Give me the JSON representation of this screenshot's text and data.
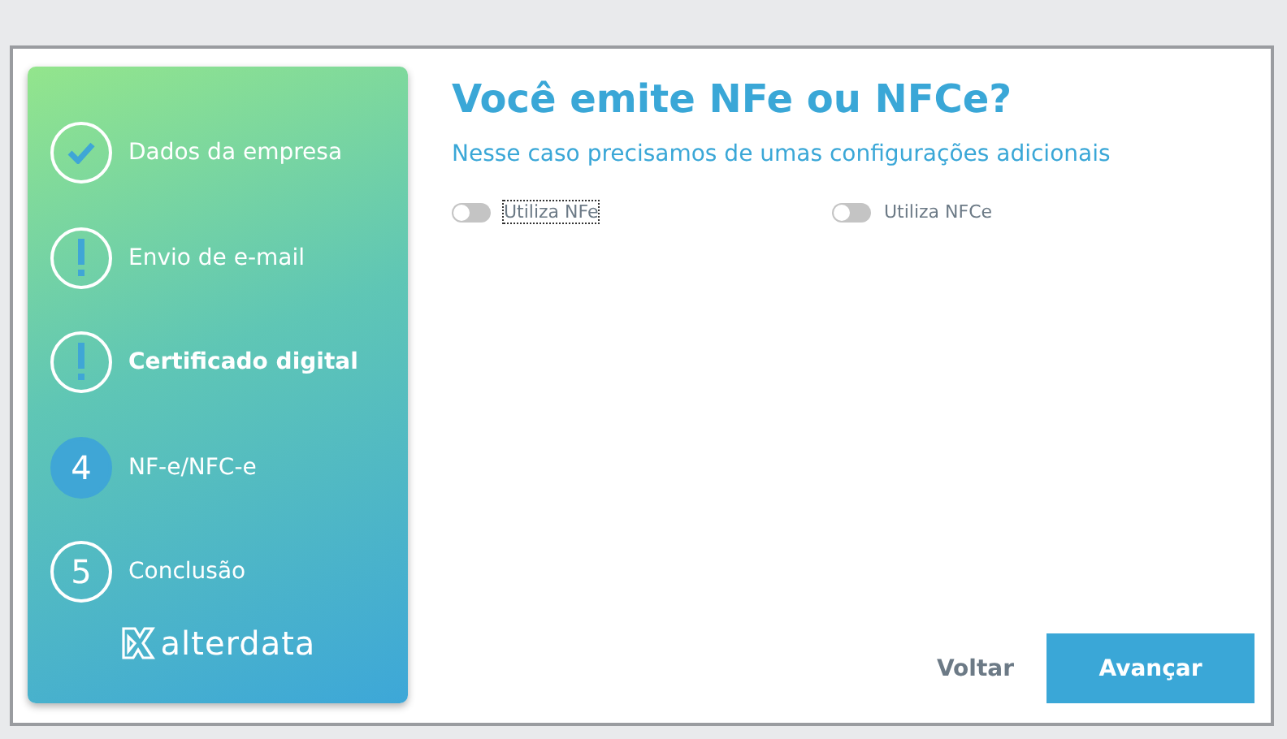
{
  "steps": [
    {
      "kind": "done",
      "label": "Dados da empresa",
      "selected": false
    },
    {
      "kind": "warning",
      "label": "Envio de e-mail",
      "selected": false
    },
    {
      "kind": "warning",
      "label": "Certificado digital",
      "selected": true
    },
    {
      "kind": "current",
      "number": "4",
      "label": "NF-e/NFC-e",
      "selected": false
    },
    {
      "kind": "pending",
      "number": "5",
      "label": "Conclusão",
      "selected": false
    }
  ],
  "brand": "alterdata",
  "title": "Você emite NFe ou NFCe?",
  "subtitle": "Nesse caso precisamos de umas configurações adicionais",
  "toggles": [
    {
      "label": "Utiliza NFe",
      "on": false,
      "focused": true
    },
    {
      "label": "Utiliza NFCe",
      "on": false,
      "focused": false
    }
  ],
  "buttons": {
    "back": "Voltar",
    "next": "Avançar"
  }
}
